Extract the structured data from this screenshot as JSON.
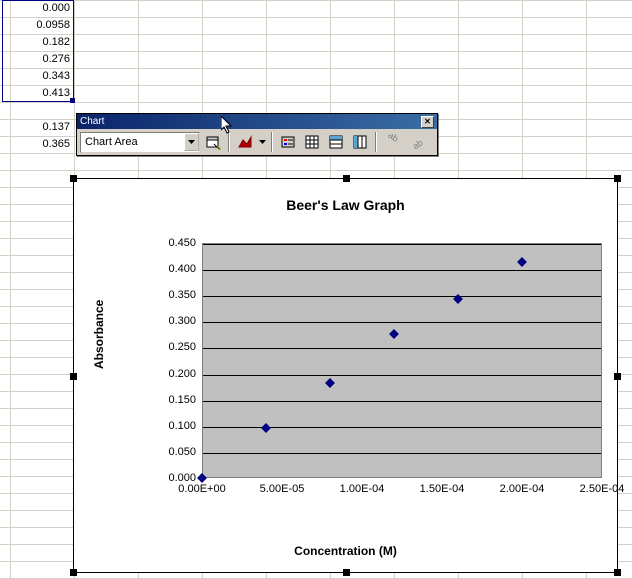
{
  "column_a": [
    "0.000",
    "0.0958",
    "0.182",
    "0.276",
    "0.343",
    "0.413"
  ],
  "column_a_extra": [
    "0.137",
    "0.365"
  ],
  "toolbar": {
    "title": "Chart",
    "dropdown_value": "Chart Area"
  },
  "chart_data": {
    "type": "scatter",
    "title": "Beer's Law Graph",
    "xlabel": "Concentration (M)",
    "ylabel": "Absorbance",
    "xlim": [
      0,
      0.00025
    ],
    "ylim": [
      0,
      0.45
    ],
    "xticks": [
      0,
      5e-05,
      0.0001,
      0.00015,
      0.0002,
      0.00025
    ],
    "xtick_labels": [
      "0.00E+00",
      "5.00E-05",
      "1.00E-04",
      "1.50E-04",
      "2.00E-04",
      "2.50E-04"
    ],
    "yticks": [
      0.0,
      0.05,
      0.1,
      0.15,
      0.2,
      0.25,
      0.3,
      0.35,
      0.4,
      0.45
    ],
    "ytick_labels": [
      "0.000",
      "0.050",
      "0.100",
      "0.150",
      "0.200",
      "0.250",
      "0.300",
      "0.350",
      "0.400",
      "0.450"
    ],
    "series": [
      {
        "name": "Absorbance",
        "x": [
          0,
          4e-05,
          8e-05,
          0.00012,
          0.00016,
          0.0002
        ],
        "y": [
          0.0,
          0.0958,
          0.182,
          0.276,
          0.343,
          0.413
        ]
      }
    ]
  }
}
